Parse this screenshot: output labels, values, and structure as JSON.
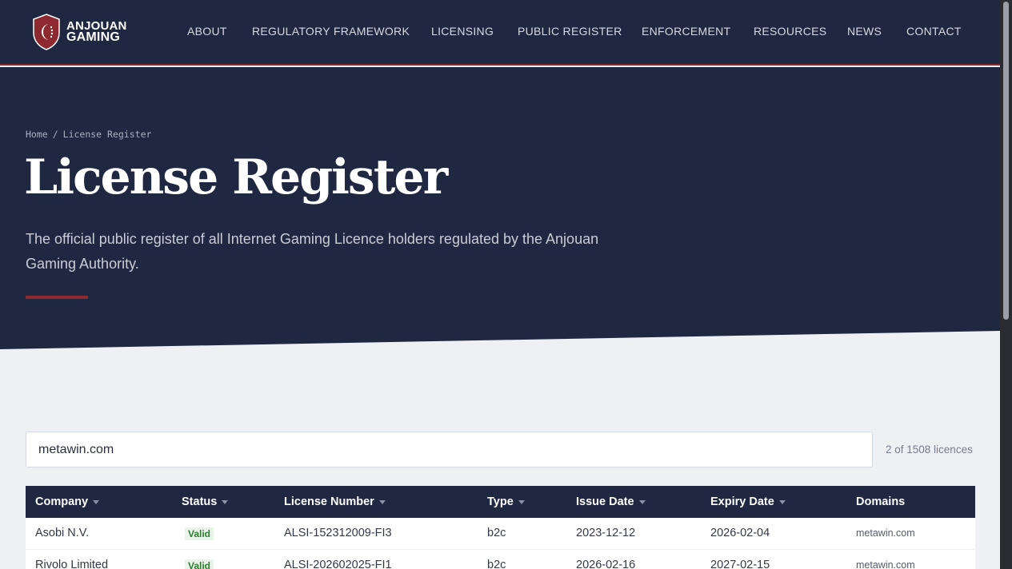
{
  "brand": {
    "line1": "ANJOUAN",
    "line2": "GAMING",
    "color": "#8e2a2f"
  },
  "nav": [
    {
      "label": "ABOUT"
    },
    {
      "label": "REGULATORY FRAMEWORK"
    },
    {
      "label": "LICENSING"
    },
    {
      "label": "PUBLIC REGISTER"
    },
    {
      "label": "ENFORCEMENT"
    },
    {
      "label": "RESOURCES"
    },
    {
      "label": "NEWS"
    },
    {
      "label": "CONTACT"
    }
  ],
  "breadcrumb": {
    "home": "Home",
    "separator": "/",
    "current": "License Register"
  },
  "hero": {
    "title": "License Register",
    "subtitle": "The official public register of all Internet Gaming Licence holders regulated by the Anjouan Gaming Authority."
  },
  "search": {
    "value": "metawin.com",
    "count_text": "2 of 1508 licences"
  },
  "table": {
    "headers": [
      "Company",
      "Status",
      "License Number",
      "Type",
      "Issue Date",
      "Expiry Date",
      "Domains"
    ],
    "rows": [
      [
        "Asobi N.V.",
        "Valid",
        "ALSI-152312009-FI3",
        "b2c",
        "2023-12-12",
        "2026-02-04",
        "metawin.com"
      ],
      [
        "Rivolo Limited",
        "Valid",
        "ALSI-202602025-FI1",
        "b2c",
        "2026-02-16",
        "2027-02-15",
        "metawin.com"
      ]
    ]
  },
  "colors": {
    "navy": "#1f2741",
    "accent": "#8e2a2f",
    "valid_bg": "#e7f4e7",
    "valid_text": "#2e7d32"
  }
}
